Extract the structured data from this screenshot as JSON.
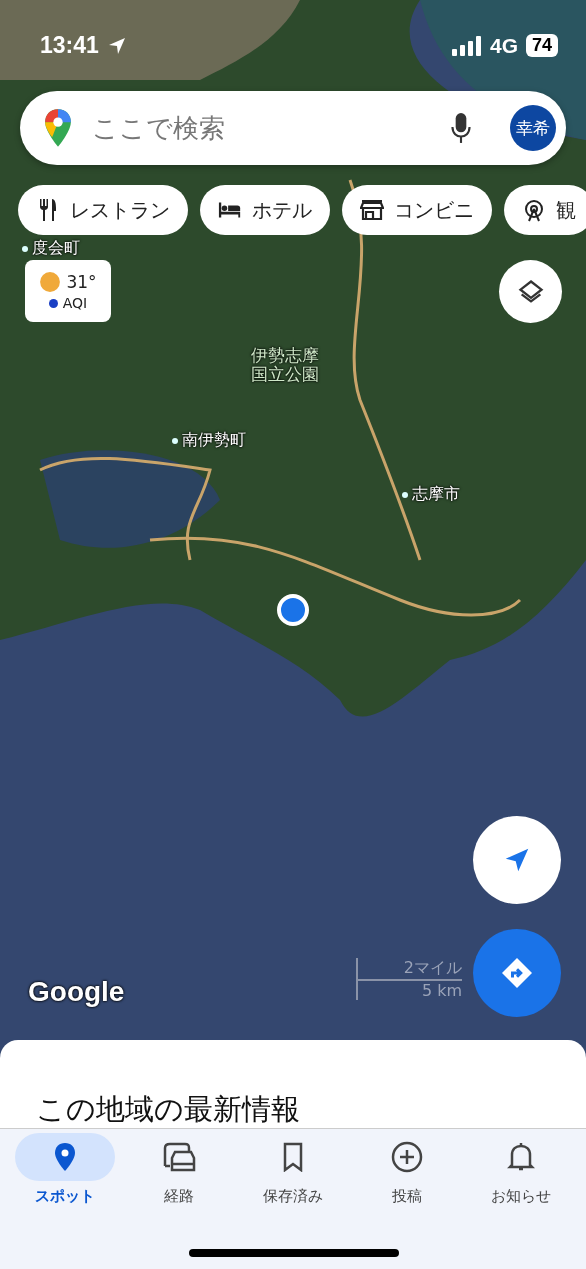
{
  "status_bar": {
    "time": "13:41",
    "network": "4G",
    "battery": "74"
  },
  "search": {
    "placeholder": "ここで検索",
    "avatar": "幸希"
  },
  "chips": [
    {
      "label": "レストラン",
      "kind": "restaurant"
    },
    {
      "label": "ホテル",
      "kind": "hotel"
    },
    {
      "label": "コンビニ",
      "kind": "store"
    },
    {
      "label": "観",
      "kind": "sight"
    }
  ],
  "weather": {
    "temperature": "31°",
    "aqi": "AQI"
  },
  "map_labels": [
    {
      "text": "度会町",
      "kind": "town"
    },
    {
      "text": "伊勢志摩国立公園",
      "kind": "park"
    },
    {
      "text": "南伊勢町",
      "kind": "town"
    },
    {
      "text": "志摩市",
      "kind": "town"
    }
  ],
  "scale": {
    "miles": "2マイル",
    "km": "5 km"
  },
  "logo": "Google",
  "sheet": {
    "title": "この地域の最新情報"
  },
  "tabs": [
    {
      "label": "スポット",
      "kind": "explore",
      "selected": true
    },
    {
      "label": "経路",
      "kind": "commute",
      "selected": false
    },
    {
      "label": "保存済み",
      "kind": "saved",
      "selected": false
    },
    {
      "label": "投稿",
      "kind": "contribute",
      "selected": false
    },
    {
      "label": "お知らせ",
      "kind": "updates",
      "selected": false
    }
  ]
}
